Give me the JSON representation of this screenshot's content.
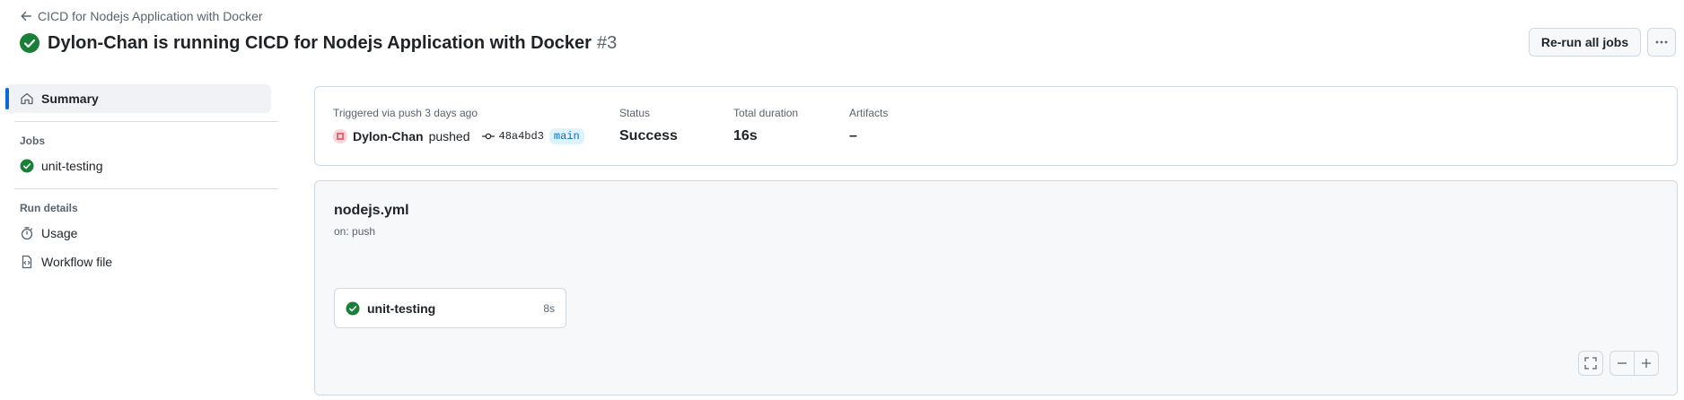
{
  "header": {
    "back_label": "CICD for Nodejs Application with Docker",
    "run_title": "Dylon-Chan is running CICD for Nodejs Application with Docker",
    "run_number": "#3",
    "rerun_label": "Re-run all jobs"
  },
  "sidebar": {
    "summary_label": "Summary",
    "jobs_heading": "Jobs",
    "jobs": [
      {
        "label": "unit-testing"
      }
    ],
    "run_details_heading": "Run details",
    "details": [
      {
        "label": "Usage"
      },
      {
        "label": "Workflow file"
      }
    ]
  },
  "summary": {
    "trigger_label": "Triggered via push 3 days ago",
    "actor": "Dylon-Chan",
    "action": "pushed",
    "commit": "48a4bd3",
    "branch": "main",
    "status_label": "Status",
    "status_value": "Success",
    "duration_label": "Total duration",
    "duration_value": "16s",
    "artifacts_label": "Artifacts",
    "artifacts_value": "–"
  },
  "graph": {
    "workflow_file": "nodejs.yml",
    "trigger": "on: push",
    "job": {
      "name": "unit-testing",
      "duration": "8s"
    }
  },
  "colors": {
    "success": "#1a7f37",
    "accent": "#0969da"
  },
  "icons": [
    "arrow-left-icon",
    "check-circle-fill-icon",
    "kebab-horizontal-icon",
    "home-icon",
    "stopwatch-icon",
    "file-code-icon",
    "git-commit-icon",
    "screen-full-icon",
    "dash-icon",
    "plus-icon"
  ]
}
